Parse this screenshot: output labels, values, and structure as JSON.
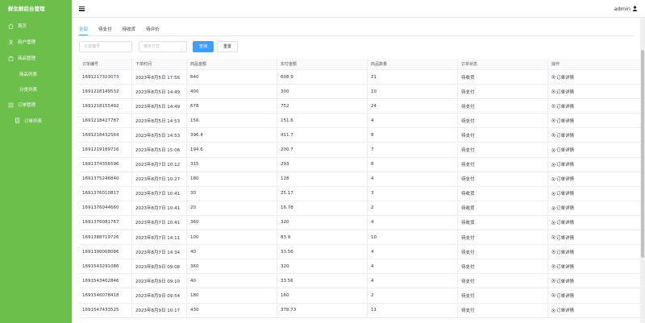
{
  "sidebar": {
    "brand": "鲜生鲜后台管理",
    "items": [
      {
        "label": "首页",
        "icon": "home-icon"
      },
      {
        "label": "用户管理",
        "icon": "user-icon"
      },
      {
        "label": "商品管理",
        "icon": "goods-icon"
      },
      {
        "label": "商品列表",
        "icon": ""
      },
      {
        "label": "分类列表",
        "icon": ""
      },
      {
        "label": "订单管理",
        "icon": "order-icon"
      },
      {
        "label": "订单列表",
        "icon": "doc-icon"
      }
    ]
  },
  "topbar": {
    "username": "admin"
  },
  "tabs": [
    {
      "label": "全部",
      "active": true
    },
    {
      "label": "待支付",
      "active": false
    },
    {
      "label": "待收货",
      "active": false
    },
    {
      "label": "待评价",
      "active": false
    }
  ],
  "filters": {
    "order_no_placeholder": "订单编号",
    "pay_method_placeholder": "缴存方式",
    "search_label": "查询",
    "reset_label": "重置"
  },
  "table": {
    "headers": [
      "订单编号",
      "下单时间",
      "商品金额",
      "实付金额",
      "商品数量",
      "订单状态",
      "操作"
    ],
    "action_label": "订单详情",
    "rows": [
      [
        "1691217323073",
        "2023年8月5日 17:56",
        "640",
        "608.9",
        "21",
        "待收货"
      ],
      [
        "1691218149532",
        "2023年8月5日 14:49",
        "400",
        "300",
        "10",
        "待支付"
      ],
      [
        "1691218155492",
        "2023年8月5日 14:49",
        "678",
        "752",
        "24",
        "待支付"
      ],
      [
        "1691218427787",
        "2023年8月5日 14:53",
        "156",
        "151.6",
        "4",
        "待支付"
      ],
      [
        "1691218432564",
        "2023年8月5日 14:53",
        "396.4",
        "411.7",
        "8",
        "待支付"
      ],
      [
        "1691219189716",
        "2023年8月5日 15:06",
        "194.6",
        "200.7",
        "7",
        "待支付"
      ],
      [
        "1691374356596",
        "2023年8月7日 10:12",
        "315",
        "293",
        "8",
        "待支付"
      ],
      [
        "1691375246840",
        "2023年8月7日 10:27",
        "180",
        "128",
        "4",
        "待支付"
      ],
      [
        "1691376010817",
        "2023年8月7日 10:41",
        "30",
        "25.17",
        "3",
        "待收货"
      ],
      [
        "1691376044660",
        "2023年8月7日 10:41",
        "20",
        "16.78",
        "2",
        "待收货"
      ],
      [
        "1691376081767",
        "2023年8月7日 10:41",
        "360",
        "320",
        "4",
        "待收货"
      ],
      [
        "1691388719726",
        "2023年8月7日 14:11",
        "100",
        "83.9",
        "10",
        "待支付"
      ],
      [
        "1691390008086",
        "2023年8月7日 14:34",
        "40",
        "33.56",
        "4",
        "待支付"
      ],
      [
        "1691543291086",
        "2023年8月9日 09:08",
        "360",
        "320",
        "4",
        "待支付"
      ],
      [
        "1691543402846",
        "2023年8月9日 09:10",
        "40",
        "33.56",
        "4",
        "待支付"
      ],
      [
        "1691546078418",
        "2023年8月9日 09:54",
        "180",
        "160",
        "2",
        "待支付"
      ],
      [
        "1691547433525",
        "2023年8月9日 10:17",
        "430",
        "378.73",
        "11",
        "待支付"
      ]
    ]
  }
}
